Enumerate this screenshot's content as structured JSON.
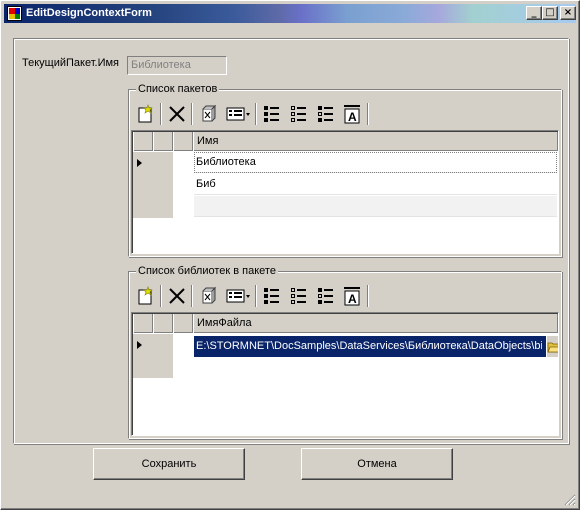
{
  "window": {
    "title": "EditDesignContextForm",
    "minimize_glyph": "_",
    "maximize_glyph": "□",
    "close_glyph": "×"
  },
  "current_package": {
    "label": "ТекущийПакет.Имя",
    "value": "Библиотека"
  },
  "packages_group": {
    "title": "Список пакетов",
    "toolbar_icons": [
      "new-icon",
      "delete-icon",
      "recycle-icon",
      "layout-icon",
      "dropdown-arrow-icon",
      "list-checked-icon",
      "list-unchecked-icon",
      "list-check-icon",
      "font-icon"
    ],
    "columns": [
      "Имя"
    ],
    "rows": [
      "Библиотека",
      "Биб"
    ]
  },
  "libraries_group": {
    "title": "Список библиотек в пакете",
    "toolbar_icons": [
      "new-icon",
      "delete-icon",
      "recycle-icon",
      "layout-icon",
      "dropdown-arrow-icon",
      "list-checked-icon",
      "list-unchecked-icon",
      "list-check-icon",
      "font-icon"
    ],
    "columns": [
      "ИмяФайла"
    ],
    "rows": [
      "E:\\STORMNET\\DocSamples\\DataServices\\Библиотека\\DataObjects\\bin\\Debug\\DataObjects.dll"
    ],
    "browse_icon": "folder-open-icon"
  },
  "buttons": {
    "save": "Сохранить",
    "cancel": "Отмена"
  }
}
